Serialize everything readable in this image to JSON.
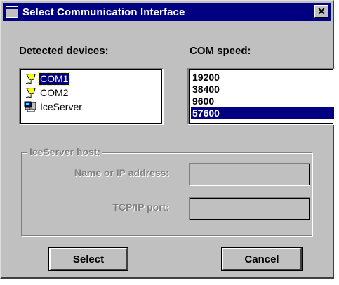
{
  "window": {
    "title": "Select Communication Interface",
    "close_glyph": "✕"
  },
  "detected": {
    "label": "Detected devices:",
    "devices": [
      {
        "name": "COM1",
        "icon": "serial-port-icon",
        "selected": true
      },
      {
        "name": "COM2",
        "icon": "serial-port-icon",
        "selected": false
      },
      {
        "name": "IceServer",
        "icon": "network-server-icon",
        "selected": false
      }
    ]
  },
  "speed": {
    "label": "COM speed:",
    "options": [
      "19200",
      "38400",
      "9600",
      "57600"
    ],
    "selected": "57600"
  },
  "iceserver": {
    "group_title": "IceServer host:",
    "name_label": "Name or IP address:",
    "name_value": "",
    "port_label": "TCP/IP port:",
    "port_value": ""
  },
  "buttons": {
    "select": "Select",
    "cancel": "Cancel"
  },
  "colors": {
    "titlebar": "#000080",
    "face": "#c0c0c0",
    "selection": "#000080"
  }
}
